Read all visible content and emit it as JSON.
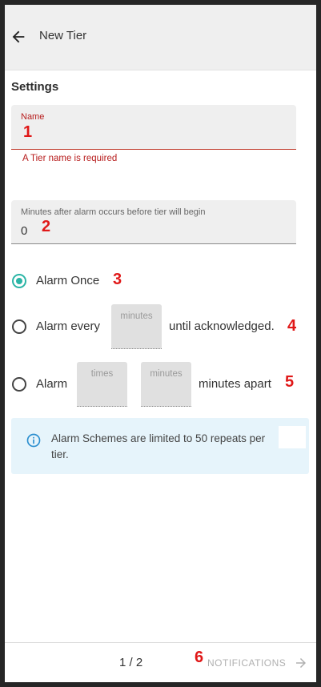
{
  "header": {
    "title": "New Tier"
  },
  "section": {
    "title": "Settings"
  },
  "name_field": {
    "label": "Name",
    "value": "",
    "error": "A Tier name is required"
  },
  "minutes_field": {
    "label": "Minutes after alarm occurs before tier will begin",
    "value": "0"
  },
  "options": {
    "once": {
      "label": "Alarm Once",
      "selected": true
    },
    "every": {
      "prefix": "Alarm every",
      "input_label": "minutes",
      "suffix": "until acknowledged.",
      "selected": false
    },
    "times": {
      "prefix": "Alarm",
      "times_label": "times",
      "minutes_label": "minutes",
      "suffix": "minutes apart",
      "selected": false
    }
  },
  "info": {
    "text": "Alarm Schemes are limited to 50 repeats per tier.",
    "icon": "info-icon"
  },
  "footer": {
    "pager": "1 / 2",
    "next_label": "NOTIFICATIONS"
  },
  "callouts": [
    "1",
    "2",
    "3",
    "4",
    "5",
    "6"
  ],
  "colors": {
    "accent": "#2bb5a6",
    "error": "#b71c1c",
    "callout": "#e01818",
    "info_bg": "#e6f4fb"
  }
}
